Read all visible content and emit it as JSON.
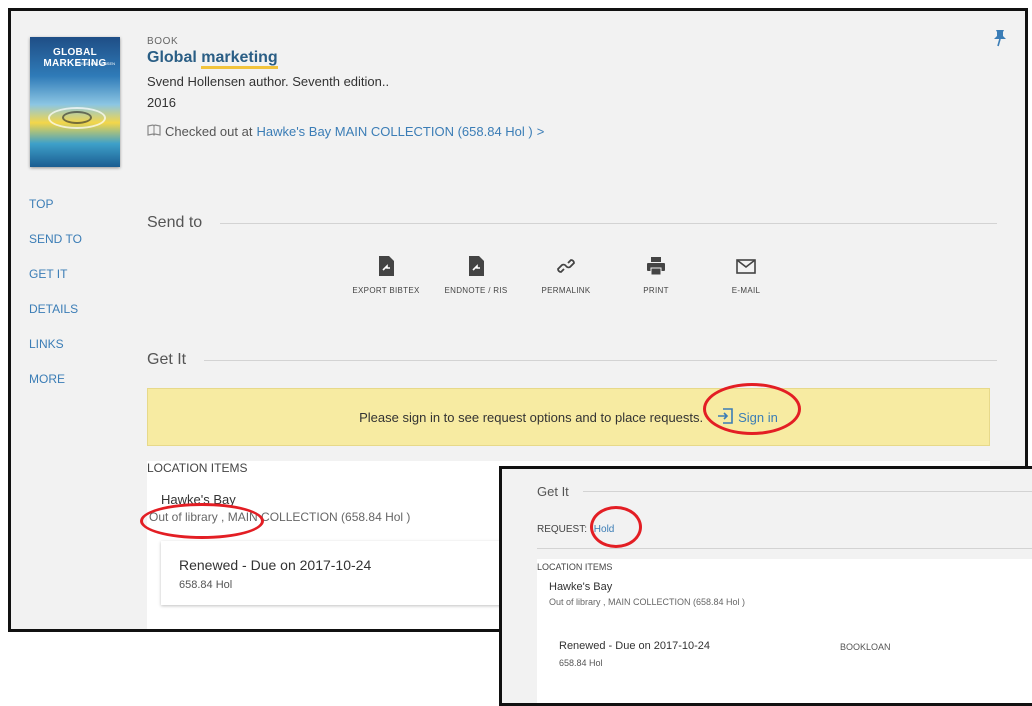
{
  "record": {
    "type": "BOOK",
    "title_plain": "Global ",
    "title_highlight": "marketing",
    "author": "Svend Hollensen author. Seventh edition..",
    "year": "2016",
    "availability_prefix": "Checked out at",
    "availability_location": "Hawke's Bay  MAIN COLLECTION (658.84 Hol )",
    "availability_chevron": ">",
    "cover": {
      "title": "GLOBAL MARKETING",
      "author": "SVEND HOLLENSEN"
    }
  },
  "side_nav": [
    "TOP",
    "SEND TO",
    "GET IT",
    "DETAILS",
    "LINKS",
    "MORE"
  ],
  "send_to": {
    "heading": "Send to",
    "actions": [
      {
        "label": "EXPORT BIBTEX",
        "icon": "export-file-icon"
      },
      {
        "label": "ENDNOTE / RIS",
        "icon": "export-file-icon"
      },
      {
        "label": "PERMALINK",
        "icon": "link-icon"
      },
      {
        "label": "PRINT",
        "icon": "printer-icon"
      },
      {
        "label": "E-MAIL",
        "icon": "envelope-icon"
      }
    ]
  },
  "get_it": {
    "heading": "Get It",
    "signin_message": "Please sign in to see request options and to place requests.",
    "signin_label": "Sign in",
    "location_header": "LOCATION ITEMS",
    "library": "Hawke's Bay",
    "status": "Out of library , MAIN COLLECTION (658.84 Hol )",
    "item_due": "Renewed - Due on 2017-10-24",
    "item_call": "658.84 Hol"
  },
  "inset": {
    "heading": "Get It",
    "request_label": "REQUEST:",
    "request_link": "Hold",
    "location_header": "LOCATION ITEMS",
    "library": "Hawke's Bay",
    "status": "Out of library , MAIN COLLECTION (658.84 Hol )",
    "item_due": "Renewed - Due on 2017-10-24",
    "item_call": "658.84 Hol",
    "item_type": "BOOKLOAN"
  },
  "colors": {
    "link": "#3b7db6",
    "annotation": "#e31e24",
    "signin_bg": "#f7eba2",
    "title": "#2a5e85"
  }
}
